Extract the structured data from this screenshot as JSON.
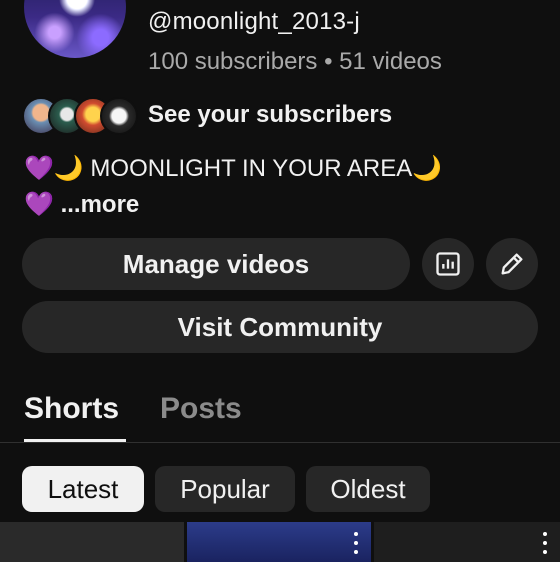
{
  "channel": {
    "handle": "@moonlight_2013-j",
    "stats": "100 subscribers • 51 videos"
  },
  "subscribers": {
    "link_label": "See your subscribers"
  },
  "description": {
    "line1": "💜🌙 MOONLIGHT IN YOUR AREA🌙",
    "line2_emoji": "💜",
    "more_label": "...more"
  },
  "actions": {
    "manage_videos": "Manage videos",
    "analytics_icon": "analytics-icon",
    "edit_icon": "pencil-icon",
    "visit_community": "Visit Community"
  },
  "tabs": [
    {
      "label": "Shorts",
      "selected": true
    },
    {
      "label": "Posts",
      "selected": false
    }
  ],
  "filters": [
    {
      "label": "Latest",
      "selected": true
    },
    {
      "label": "Popular",
      "selected": false
    },
    {
      "label": "Oldest",
      "selected": false
    }
  ],
  "colors": {
    "background": "#0f0f0f",
    "surface": "#272727",
    "text": "#f1f1f1",
    "muted": "#aaaaaa"
  }
}
